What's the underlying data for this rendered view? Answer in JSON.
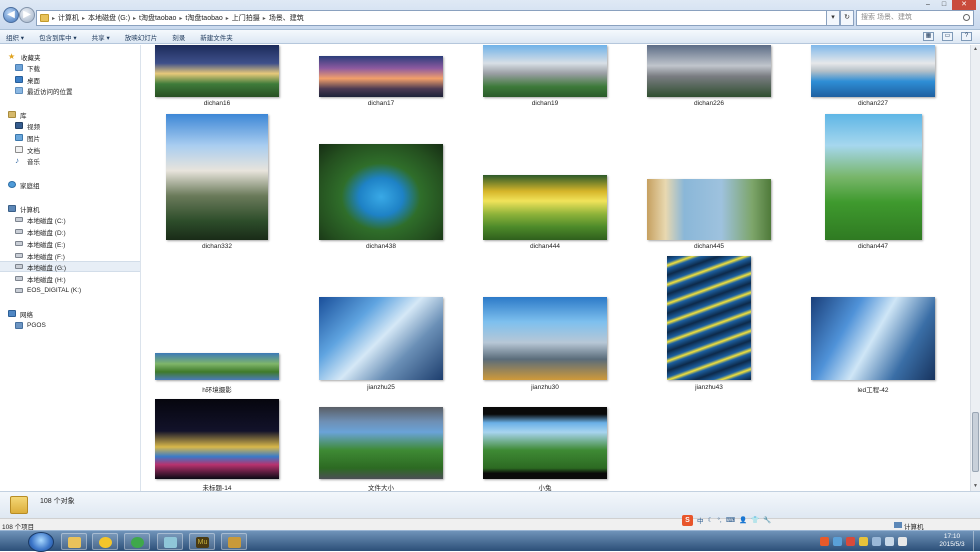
{
  "address": {
    "crumbs": [
      "计算机",
      "本地磁盘 (G:)",
      "t淘盘taobao",
      "t淘盘taobao",
      "上门拍摄",
      "场景、建筑"
    ],
    "search_placeholder": "搜索 场景、建筑",
    "refresh_icon": "refresh-icon",
    "back_icon": "back-arrow-icon",
    "forward_icon": "forward-arrow-icon"
  },
  "window_controls": {
    "minimize": "–",
    "maximize": "□",
    "close": "✕"
  },
  "toolbar": {
    "items": [
      "组织 ▾",
      "包含到库中 ▾",
      "共享 ▾",
      "放映幻灯片",
      "刻录",
      "新建文件夹"
    ],
    "view_label": "▦",
    "preview_label": "▭",
    "help_label": "?"
  },
  "sidebar": {
    "favorites": {
      "label": "收藏夹",
      "items": [
        "下载",
        "桌面",
        "最近访问的位置"
      ]
    },
    "libraries": {
      "label": "库",
      "items": [
        "视频",
        "图片",
        "文档",
        "音乐"
      ]
    },
    "homegroup": {
      "label": "家庭组"
    },
    "computer": {
      "label": "计算机",
      "items": [
        "本地磁盘 (C:)",
        "本地磁盘 (D:)",
        "本地磁盘 (E:)",
        "本地磁盘 (F:)",
        "本地磁盘 (G:)",
        "本地磁盘 (H:)",
        "EOS_DIGITAL (K:)"
      ],
      "selected": "本地磁盘 (G:)"
    },
    "network": {
      "label": "网络",
      "items": [
        "PGOS"
      ]
    }
  },
  "files": [
    {
      "name": "dichan16"
    },
    {
      "name": "dichan17"
    },
    {
      "name": "dichan19"
    },
    {
      "name": "dichan226"
    },
    {
      "name": "dichan227"
    },
    {
      "name": "dichan332"
    },
    {
      "name": "dichan438"
    },
    {
      "name": "dichan444"
    },
    {
      "name": "dichan445"
    },
    {
      "name": "dichan447"
    },
    {
      "name": "h环境摄影"
    },
    {
      "name": "jianzhu25"
    },
    {
      "name": "jianzhu30"
    },
    {
      "name": "jianzhu43"
    },
    {
      "name": "led工程-42"
    },
    {
      "name": "未标题-14"
    },
    {
      "name": "文件大小"
    },
    {
      "name": "小兔"
    }
  ],
  "details": {
    "count": "108 个对象"
  },
  "status": {
    "left": "108 个项目",
    "right": "计算机"
  },
  "ime": {
    "logo": "S",
    "mode": "中",
    "symbols": [
      "☾",
      "°,",
      "⌨",
      "👤",
      "👕",
      "🔧"
    ]
  },
  "clock": {
    "time": "17:10",
    "date": "2015/5/3"
  },
  "taskbar": {
    "apps": [
      "explorer-icon",
      "qq-icon",
      "browser-icon",
      "media-icon",
      "muse-icon",
      "gold-icon"
    ]
  }
}
